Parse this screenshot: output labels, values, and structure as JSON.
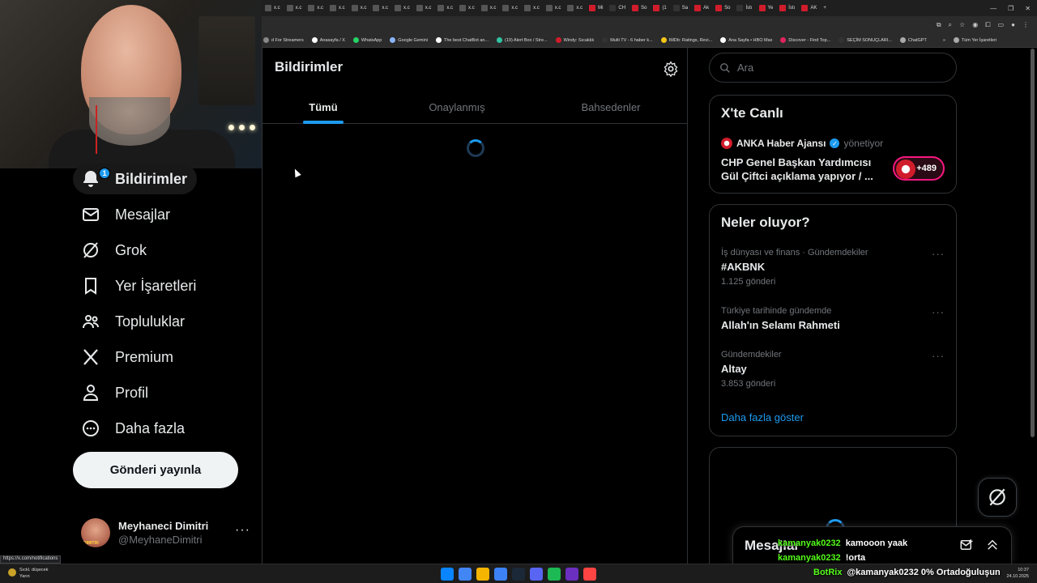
{
  "browser": {
    "tabs": [
      {
        "label": "x.c",
        "color": "#555"
      },
      {
        "label": "x.c",
        "color": "#555"
      },
      {
        "label": "x.c",
        "color": "#555"
      },
      {
        "label": "x.c",
        "color": "#555"
      },
      {
        "label": "x.c",
        "color": "#555"
      },
      {
        "label": "x.c",
        "color": "#555"
      },
      {
        "label": "x.c",
        "color": "#555"
      },
      {
        "label": "x.c",
        "color": "#555"
      },
      {
        "label": "x.c",
        "color": "#555"
      },
      {
        "label": "x.c",
        "color": "#555"
      },
      {
        "label": "x.c",
        "color": "#555"
      },
      {
        "label": "x.c",
        "color": "#555"
      },
      {
        "label": "x.c",
        "color": "#555"
      },
      {
        "label": "x.c",
        "color": "#555"
      },
      {
        "label": "x.c",
        "color": "#555"
      },
      {
        "label": "Mi",
        "color": "#d01c2b"
      },
      {
        "label": "CH",
        "color": "#333"
      },
      {
        "label": "So",
        "color": "#d01c2b"
      },
      {
        "label": "(1",
        "color": "#d01c2b"
      },
      {
        "label": "Sa",
        "color": "#333"
      },
      {
        "label": "Ak",
        "color": "#d01c2b"
      },
      {
        "label": "So",
        "color": "#d01c2b"
      },
      {
        "label": "İstı",
        "color": "#333"
      },
      {
        "label": "Ye",
        "color": "#d01c2b"
      },
      {
        "label": "İstı",
        "color": "#d01c2b"
      },
      {
        "label": "AK",
        "color": "#d01c2b"
      }
    ],
    "bookmarks": [
      {
        "label": "d For Streamers",
        "color": "#888"
      },
      {
        "label": "Anasayfa / X",
        "color": "#fff"
      },
      {
        "label": "WhatsApp",
        "color": "#25d366"
      },
      {
        "label": "Google Gemini",
        "color": "#8ab4f8"
      },
      {
        "label": "The best ChatBot an...",
        "color": "#fff"
      },
      {
        "label": "(19) Alert Box / Stre...",
        "color": "#32c3a2"
      },
      {
        "label": "Windy: Sıcaklık",
        "color": "#d01c2b"
      },
      {
        "label": "Multi TV - 6 haber k...",
        "color": "#333"
      },
      {
        "label": "IMDb: Ratings, Revi...",
        "color": "#f5c518"
      },
      {
        "label": "Ana Sayfa • HBO Max",
        "color": "#fff"
      },
      {
        "label": "Discover - Find Top...",
        "color": "#e0245e"
      },
      {
        "label": "SEÇİM SONUÇLARI...",
        "color": "#333"
      },
      {
        "label": "ChatGPT",
        "color": "#aaa"
      },
      {
        "label": "»",
        "color": "#2b2b2b"
      },
      {
        "label": "Tüm Yer İşaretleri",
        "color": "#aaa"
      }
    ]
  },
  "nav": {
    "notifications_label": "Bildirimler",
    "notifications_badge": "1",
    "messages_label": "Mesajlar",
    "grok_label": "Grok",
    "bookmarks_label": "Yer İşaretleri",
    "communities_label": "Topluluklar",
    "premium_label": "Premium",
    "profile_label": "Profil",
    "more_label": "Daha fazla",
    "post_button_label": "Gönderi yayınla"
  },
  "profile": {
    "name": "Meyhaneci Dimitri",
    "handle": "@MeyhaneDimitri",
    "more": "···"
  },
  "main": {
    "title": "Bildirimler",
    "tabs": [
      {
        "label": "Tümü",
        "active": true
      },
      {
        "label": "Onaylanmış",
        "active": false
      },
      {
        "label": "Bahsedenler",
        "active": false
      }
    ]
  },
  "sidebar": {
    "search_placeholder": "Ara",
    "live": {
      "title": "X'te Canlı",
      "host": "ANKA Haber Ajansı",
      "host_role": "yönetiyor",
      "text": "CHP Genel Başkan Yardımcısı Gül Çiftci açıklama yapıyor / ...",
      "listeners": "+489"
    },
    "trends": {
      "title": "Neler oluyor?",
      "items": [
        {
          "meta": "İş dünyası ve finans · Gündemdekiler",
          "name": "#AKBNK",
          "count": "1.125 gönderi"
        },
        {
          "meta": "Türkiye tarihinde gündemde",
          "name": "Allah'ın Selamı Rahmeti",
          "count": ""
        },
        {
          "meta": "Gündemdekiler",
          "name": "Altay",
          "count": "3.853 gönderi"
        }
      ],
      "show_more": "Daha fazla göster"
    },
    "messages_title": "Mesajlar"
  },
  "chat": [
    {
      "user": "kamanyak0232",
      "message": "kamooon yaak"
    },
    {
      "user": "kamanyak0232",
      "message": "!orta"
    }
  ],
  "status_url": "https://x.com/notifications",
  "taskbar": {
    "weather_line1": "Sıckl. düşecek",
    "weather_line2": "Yarın",
    "botrix_name": "BotRix",
    "botrix_text": "@kamanyak0232 0% Ortadoğuluşun",
    "time": "10:37",
    "date": "24.10.2025",
    "apps": [
      "#0a84ff",
      "#4285f4",
      "#f5b400",
      "#3c82f6",
      "#1b2838",
      "#5865f2",
      "#1db954",
      "#6b2fbf",
      "#ff4444"
    ]
  },
  "colors": {
    "accent": "#1d9bf0",
    "background": "#000000",
    "live_pink": "#f91880",
    "chat_green": "#53fc18"
  }
}
